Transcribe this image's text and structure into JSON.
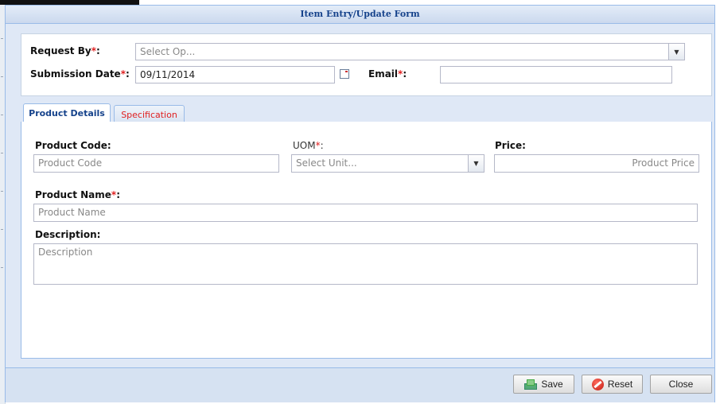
{
  "window": {
    "title": "Item Entry/Update Form"
  },
  "header_form": {
    "request_by": {
      "label": "Request By",
      "required_mark": "*",
      "colon": ":",
      "placeholder": "Select Op..."
    },
    "submission_date": {
      "label": "Submission Date",
      "required_mark": "*",
      "colon": ":",
      "value": "09/11/2014"
    },
    "email": {
      "label": "Email",
      "required_mark": "*",
      "colon": ":",
      "value": ""
    }
  },
  "tabs": [
    {
      "label": "Product Details",
      "active": true
    },
    {
      "label": "Specification",
      "active": false
    }
  ],
  "product_details": {
    "product_code": {
      "label": "Product Code:",
      "placeholder": "Product Code"
    },
    "uom": {
      "label": "UOM",
      "required_mark": "*",
      "colon": ":",
      "placeholder": "Select Unit..."
    },
    "price": {
      "label": "Price:",
      "placeholder": "Product Price"
    },
    "product_name": {
      "label": "Product Name",
      "required_mark": "*",
      "colon": ":",
      "placeholder": "Product Name"
    },
    "description": {
      "label": "Description:",
      "placeholder": "Description"
    }
  },
  "buttons": {
    "save": "Save",
    "reset": "Reset",
    "close": "Close"
  },
  "icons": {
    "combo_trigger": "chevron-down-icon",
    "date_trigger": "calendar-icon",
    "save": "save-icon",
    "reset": "reset-icon"
  },
  "colors": {
    "title_text": "#15428b",
    "required": "#e02020",
    "window_border": "#99bbe8",
    "footer_bg": "#d6e2f2"
  }
}
